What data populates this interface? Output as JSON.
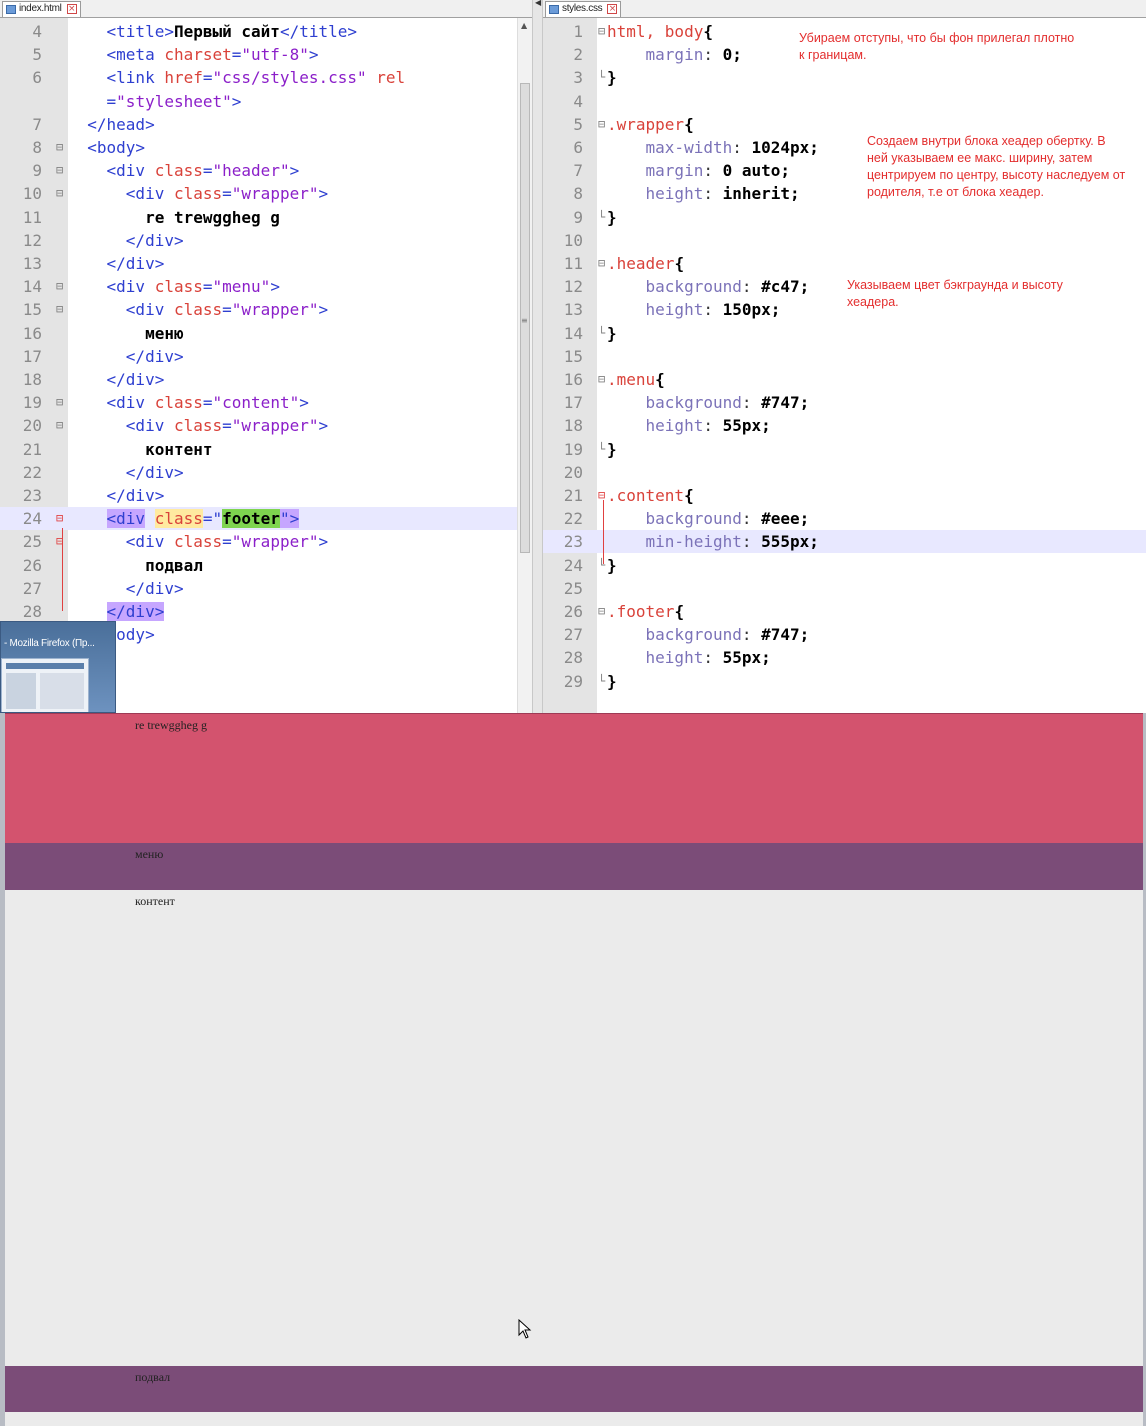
{
  "left_editor": {
    "tab_label": "index.html",
    "lines": [
      {
        "n": "4",
        "parts": [
          [
            "",
            "    "
          ],
          [
            "tag",
            "<title>"
          ],
          [
            "txt",
            "Первый сайт"
          ],
          [
            "tag",
            "</title>"
          ]
        ]
      },
      {
        "n": "5",
        "parts": [
          [
            "",
            "    "
          ],
          [
            "tag",
            "<meta "
          ],
          [
            "attr",
            "charset"
          ],
          [
            "tag",
            "="
          ],
          [
            "val",
            "\"utf-8\""
          ],
          [
            "tag",
            ">"
          ]
        ]
      },
      {
        "n": "6",
        "parts": [
          [
            "",
            "    "
          ],
          [
            "tag",
            "<link "
          ],
          [
            "attr",
            "href"
          ],
          [
            "tag",
            "="
          ],
          [
            "val",
            "\"css/styles.css\""
          ],
          [
            "tag",
            " "
          ],
          [
            "attr",
            "rel"
          ]
        ]
      },
      {
        "n": "",
        "parts": [
          [
            "",
            "    "
          ],
          [
            "tag",
            "="
          ],
          [
            "val",
            "\"stylesheet\""
          ],
          [
            "tag",
            ">"
          ]
        ]
      },
      {
        "n": "7",
        "parts": [
          [
            "",
            "  "
          ],
          [
            "tag",
            "</head>"
          ]
        ]
      },
      {
        "n": "8",
        "parts": [
          [
            "",
            "  "
          ],
          [
            "tag",
            "<body>"
          ]
        ]
      },
      {
        "n": "9",
        "parts": [
          [
            "",
            "    "
          ],
          [
            "tag",
            "<div "
          ],
          [
            "attr",
            "class"
          ],
          [
            "tag",
            "="
          ],
          [
            "val",
            "\"header\""
          ],
          [
            "tag",
            ">"
          ]
        ]
      },
      {
        "n": "10",
        "parts": [
          [
            "",
            "      "
          ],
          [
            "tag",
            "<div "
          ],
          [
            "attr",
            "class"
          ],
          [
            "tag",
            "="
          ],
          [
            "val",
            "\"wrapper\""
          ],
          [
            "tag",
            ">"
          ]
        ]
      },
      {
        "n": "11",
        "parts": [
          [
            "",
            "        "
          ],
          [
            "txt",
            "re trewggheg g"
          ]
        ]
      },
      {
        "n": "12",
        "parts": [
          [
            "",
            "      "
          ],
          [
            "tag",
            "</div>"
          ]
        ]
      },
      {
        "n": "13",
        "parts": [
          [
            "",
            "    "
          ],
          [
            "tag",
            "</div>"
          ]
        ]
      },
      {
        "n": "14",
        "parts": [
          [
            "",
            "    "
          ],
          [
            "tag",
            "<div "
          ],
          [
            "attr",
            "class"
          ],
          [
            "tag",
            "="
          ],
          [
            "val",
            "\"menu\""
          ],
          [
            "tag",
            ">"
          ]
        ]
      },
      {
        "n": "15",
        "parts": [
          [
            "",
            "      "
          ],
          [
            "tag",
            "<div "
          ],
          [
            "attr",
            "class"
          ],
          [
            "tag",
            "="
          ],
          [
            "val",
            "\"wrapper\""
          ],
          [
            "tag",
            ">"
          ]
        ]
      },
      {
        "n": "16",
        "parts": [
          [
            "",
            "        "
          ],
          [
            "txt",
            "меню"
          ]
        ]
      },
      {
        "n": "17",
        "parts": [
          [
            "",
            "      "
          ],
          [
            "tag",
            "</div>"
          ]
        ]
      },
      {
        "n": "18",
        "parts": [
          [
            "",
            "    "
          ],
          [
            "tag",
            "</div>"
          ]
        ]
      },
      {
        "n": "19",
        "parts": [
          [
            "",
            "    "
          ],
          [
            "tag",
            "<div "
          ],
          [
            "attr",
            "class"
          ],
          [
            "tag",
            "="
          ],
          [
            "val",
            "\"content\""
          ],
          [
            "tag",
            ">"
          ]
        ]
      },
      {
        "n": "20",
        "parts": [
          [
            "",
            "      "
          ],
          [
            "tag",
            "<div "
          ],
          [
            "attr",
            "class"
          ],
          [
            "tag",
            "="
          ],
          [
            "val",
            "\"wrapper\""
          ],
          [
            "tag",
            ">"
          ]
        ]
      },
      {
        "n": "21",
        "parts": [
          [
            "",
            "        "
          ],
          [
            "txt",
            "контент"
          ]
        ]
      },
      {
        "n": "22",
        "parts": [
          [
            "",
            "      "
          ],
          [
            "tag",
            "</div>"
          ]
        ]
      },
      {
        "n": "23",
        "parts": [
          [
            "",
            "    "
          ],
          [
            "tag",
            "</div>"
          ]
        ]
      },
      {
        "n": "24",
        "highlight": true,
        "parts": [
          [
            "",
            "    "
          ],
          [
            "tag-bm",
            "<div"
          ],
          [
            "tag",
            " "
          ],
          [
            "attr-bm",
            "class"
          ],
          [
            "tag",
            "=\""
          ],
          [
            "word-bm",
            "footer"
          ],
          [
            "tag-bm",
            "\">"
          ]
        ]
      },
      {
        "n": "25",
        "parts": [
          [
            "",
            "      "
          ],
          [
            "tag",
            "<div "
          ],
          [
            "attr",
            "class"
          ],
          [
            "tag",
            "="
          ],
          [
            "val",
            "\"wrapper\""
          ],
          [
            "tag",
            ">"
          ]
        ]
      },
      {
        "n": "26",
        "parts": [
          [
            "",
            "        "
          ],
          [
            "txt",
            "подвал"
          ]
        ]
      },
      {
        "n": "27",
        "parts": [
          [
            "",
            "      "
          ],
          [
            "tag",
            "</div>"
          ]
        ]
      },
      {
        "n": "28",
        "parts": [
          [
            "",
            "    "
          ],
          [
            "tag-bm",
            "</div>"
          ]
        ]
      },
      {
        "n": "",
        "parts": [
          [
            "",
            "  "
          ],
          [
            "tag",
            "</body>"
          ]
        ]
      },
      {
        "n": "",
        "parts": [
          [
            "tag",
            "ml>"
          ]
        ]
      }
    ]
  },
  "right_editor": {
    "tab_label": "styles.css",
    "lines": [
      {
        "n": "1",
        "parts": [
          [
            "sel",
            "html, body"
          ],
          [
            "brace",
            "{"
          ]
        ]
      },
      {
        "n": "2",
        "parts": [
          [
            "",
            "    "
          ],
          [
            "prop",
            "margin"
          ],
          [
            "plain",
            ": "
          ],
          [
            "num",
            "0;"
          ]
        ]
      },
      {
        "n": "3",
        "parts": [
          [
            "brace",
            "}"
          ]
        ]
      },
      {
        "n": "4",
        "parts": []
      },
      {
        "n": "5",
        "parts": [
          [
            "sel",
            ".wrapper"
          ],
          [
            "brace",
            "{"
          ]
        ]
      },
      {
        "n": "6",
        "parts": [
          [
            "",
            "    "
          ],
          [
            "prop",
            "max-width"
          ],
          [
            "plain",
            ": "
          ],
          [
            "num",
            "1024px;"
          ]
        ]
      },
      {
        "n": "7",
        "parts": [
          [
            "",
            "    "
          ],
          [
            "prop",
            "margin"
          ],
          [
            "plain",
            ": "
          ],
          [
            "num",
            "0 auto;"
          ]
        ]
      },
      {
        "n": "8",
        "parts": [
          [
            "",
            "    "
          ],
          [
            "prop",
            "height"
          ],
          [
            "plain",
            ": "
          ],
          [
            "num",
            "inherit;"
          ]
        ]
      },
      {
        "n": "9",
        "parts": [
          [
            "brace",
            "}"
          ]
        ]
      },
      {
        "n": "10",
        "parts": []
      },
      {
        "n": "11",
        "parts": [
          [
            "sel",
            ".header"
          ],
          [
            "brace",
            "{"
          ]
        ]
      },
      {
        "n": "12",
        "parts": [
          [
            "",
            "    "
          ],
          [
            "prop",
            "background"
          ],
          [
            "plain",
            ": "
          ],
          [
            "num",
            "#c47;"
          ]
        ]
      },
      {
        "n": "13",
        "parts": [
          [
            "",
            "    "
          ],
          [
            "prop",
            "height"
          ],
          [
            "plain",
            ": "
          ],
          [
            "num",
            "150px;"
          ]
        ]
      },
      {
        "n": "14",
        "parts": [
          [
            "brace",
            "}"
          ]
        ]
      },
      {
        "n": "15",
        "parts": []
      },
      {
        "n": "16",
        "parts": [
          [
            "sel",
            ".menu"
          ],
          [
            "brace",
            "{"
          ]
        ]
      },
      {
        "n": "17",
        "parts": [
          [
            "",
            "    "
          ],
          [
            "prop",
            "background"
          ],
          [
            "plain",
            ": "
          ],
          [
            "num",
            "#747;"
          ]
        ]
      },
      {
        "n": "18",
        "parts": [
          [
            "",
            "    "
          ],
          [
            "prop",
            "height"
          ],
          [
            "plain",
            ": "
          ],
          [
            "num",
            "55px;"
          ]
        ]
      },
      {
        "n": "19",
        "parts": [
          [
            "brace",
            "}"
          ]
        ]
      },
      {
        "n": "20",
        "parts": []
      },
      {
        "n": "21",
        "parts": [
          [
            "sel",
            ".content"
          ],
          [
            "brace",
            "{"
          ]
        ]
      },
      {
        "n": "22",
        "parts": [
          [
            "",
            "    "
          ],
          [
            "prop",
            "background"
          ],
          [
            "plain",
            ": "
          ],
          [
            "num",
            "#eee;"
          ]
        ]
      },
      {
        "n": "23",
        "highlight": true,
        "parts": [
          [
            "",
            "    "
          ],
          [
            "prop",
            "min-height"
          ],
          [
            "plain",
            ": "
          ],
          [
            "num",
            "555px;"
          ]
        ]
      },
      {
        "n": "24",
        "parts": [
          [
            "brace",
            "}"
          ]
        ]
      },
      {
        "n": "25",
        "parts": []
      },
      {
        "n": "26",
        "parts": [
          [
            "sel",
            ".footer"
          ],
          [
            "brace",
            "{"
          ]
        ]
      },
      {
        "n": "27",
        "parts": [
          [
            "",
            "    "
          ],
          [
            "prop",
            "background"
          ],
          [
            "plain",
            ": "
          ],
          [
            "num",
            "#747;"
          ]
        ]
      },
      {
        "n": "28",
        "parts": [
          [
            "",
            "    "
          ],
          [
            "prop",
            "height"
          ],
          [
            "plain",
            ": "
          ],
          [
            "num",
            "55px;"
          ]
        ]
      },
      {
        "n": "29",
        "parts": [
          [
            "brace",
            "}"
          ]
        ]
      }
    ]
  },
  "notes": {
    "note1": "Убираем отступы, что бы фон прилегал плотно к границам.",
    "note2": "Создаем внутри блока хеадер обертку. В ней указываем ее макс. ширину, затем центрируем по центру, высоту наследуем от родителя, т.е от блока хеадер.",
    "note3": "Указываем  цвет бэкграунда и высоту хеадера."
  },
  "taskbar_thumbnail": {
    "title": "- Mozilla Firefox (Пр..."
  },
  "browser_page": {
    "header_text": "re trewggheg g",
    "menu_text": "меню",
    "content_text": "контент",
    "footer_text": "подвал",
    "colors": {
      "header": "#d3536e",
      "menu": "#7b4c78",
      "content": "#ebebeb",
      "footer": "#7b4c78"
    }
  }
}
